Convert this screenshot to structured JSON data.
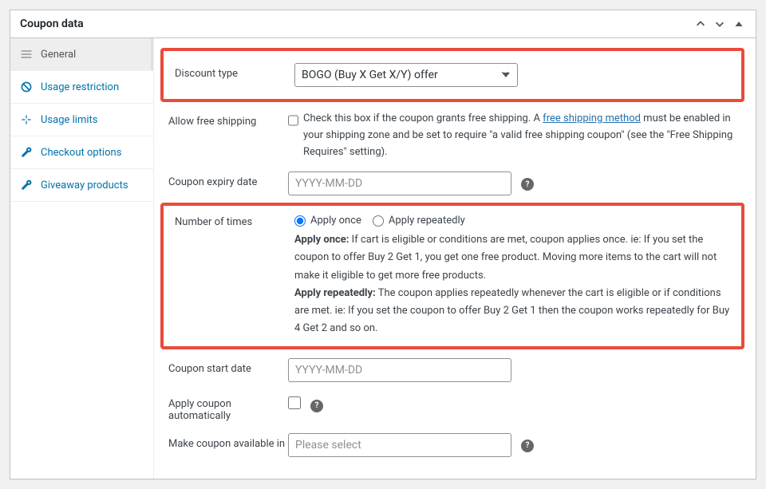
{
  "panel": {
    "title": "Coupon data"
  },
  "tabs": [
    {
      "label": "General",
      "icon": "general"
    },
    {
      "label": "Usage restriction",
      "icon": "restriction"
    },
    {
      "label": "Usage limits",
      "icon": "limits"
    },
    {
      "label": "Checkout options",
      "icon": "wrench"
    },
    {
      "label": "Giveaway products",
      "icon": "wrench"
    }
  ],
  "fields": {
    "discount_type": {
      "label": "Discount type",
      "value": "BOGO (Buy X Get X/Y) offer"
    },
    "free_shipping": {
      "label": "Allow free shipping",
      "help_prefix": "Check this box if the coupon grants free shipping. A ",
      "help_link": "free shipping method",
      "help_suffix": " must be enabled in your shipping zone and be set to require \"a valid free shipping coupon\" (see the \"Free Shipping Requires\" setting)."
    },
    "expiry": {
      "label": "Coupon expiry date",
      "placeholder": "YYYY-MM-DD"
    },
    "num_times": {
      "label": "Number of times",
      "opt1": "Apply once",
      "opt2": "Apply repeatedly",
      "help1_label": "Apply once:",
      "help1_text": " If cart is eligible or conditions are met, coupon applies once. ie: If you set the coupon to offer Buy 2 Get 1, you get one free product. Moving more items to the cart will not make it eligible to get more free products.",
      "help2_label": "Apply repeatedly:",
      "help2_text": " The coupon applies repeatedly whenever the cart is eligible or if conditions are met. ie: If you set the coupon to offer Buy 2 Get 1 then the coupon works repeatedly for Buy 4 Get 2 and so on."
    },
    "start_date": {
      "label": "Coupon start date",
      "placeholder": "YYYY-MM-DD"
    },
    "auto_apply": {
      "label": "Apply coupon automatically"
    },
    "available_in": {
      "label": "Make coupon available in",
      "placeholder": "Please select"
    }
  }
}
